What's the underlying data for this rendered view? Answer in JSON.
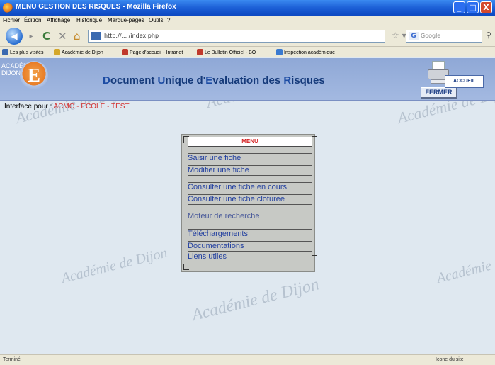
{
  "window": {
    "title": "MENU GESTION DES RISQUES - Mozilla Firefox",
    "min_label": "_",
    "max_label": "□",
    "close_label": "X"
  },
  "menubar": [
    "Fichier",
    "Édition",
    "Affichage",
    "Historique",
    "Marque-pages",
    "Outils",
    "?"
  ],
  "navbar": {
    "back_label": "◀",
    "forward_label": "▸",
    "reload_label": "C",
    "stop_label": "✕",
    "home_label": "⌂",
    "url": "http://... /index.php",
    "search_placeholder": "Google"
  },
  "bookmarks": [
    {
      "label": "Les plus visités",
      "color": "#3b6ab0"
    },
    {
      "label": "Académie de Dijon",
      "color": "#d4a72a"
    },
    {
      "label": "Page d'accueil - Intranet",
      "color": "#c0392b"
    },
    {
      "label": "Le Bulletin Officiel - BO",
      "color": "#c0392b"
    },
    {
      "label": "Inspection académique",
      "color": "#3a7ad0"
    }
  ],
  "header": {
    "logo_text": "ACADÉMIE DIJON",
    "logo_letter": "E",
    "title_parts": [
      "D",
      "ocument ",
      "U",
      "nique d'",
      "E",
      "valuation des ",
      "R",
      "isques"
    ],
    "fermer_label": "FERMER",
    "accueil_label": "ACCUEIL"
  },
  "interface": {
    "prefix": "Interface pour : ",
    "value": "ACMO - ECOLE - TEST"
  },
  "watermark": "Académie de Dijon",
  "menu": {
    "title": "MENU",
    "items": [
      "Saisir une fiche",
      "Modifier une fiche",
      "Consulter une fiche en cours",
      "Consulter une fiche cloturée",
      "Moteur de recherche",
      "Téléchargements",
      "Documentations",
      "Liens utiles"
    ]
  },
  "status": {
    "left": "Terminé",
    "right": "Icone du site"
  },
  "colors": {
    "title_accent": "#d42020",
    "link": "#2340a0",
    "header_bg": "#a3b9e1"
  }
}
